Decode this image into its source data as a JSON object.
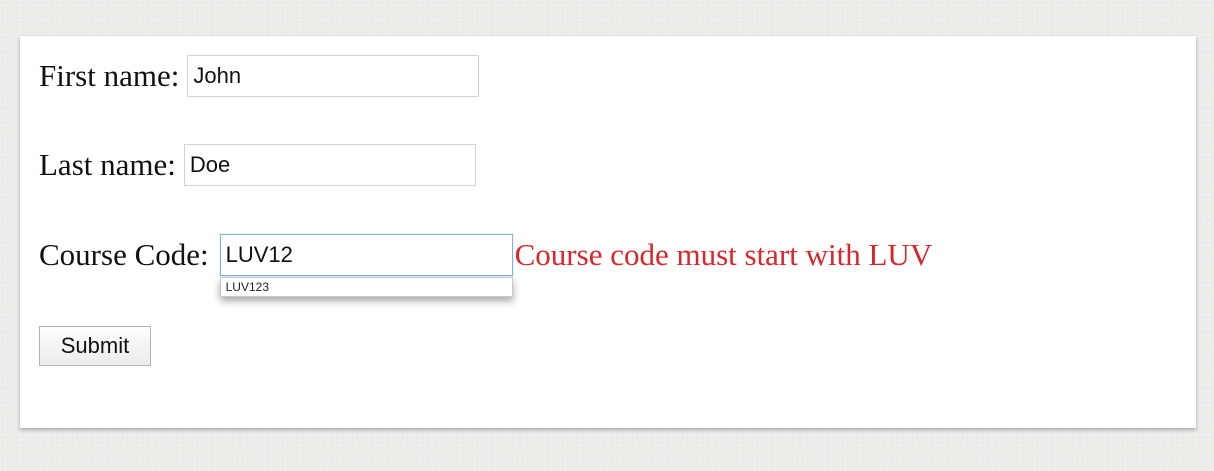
{
  "form": {
    "first_name": {
      "label": "First name:",
      "value": "John"
    },
    "last_name": {
      "label": "Last name:",
      "value": "Doe"
    },
    "course_code": {
      "label": "Course Code:",
      "value": "LUV12",
      "error": "Course code must start with LUV",
      "autocomplete_suggestions": [
        "LUV123"
      ]
    },
    "submit_label": "Submit"
  },
  "colors": {
    "error": "#d8262b",
    "focus_border": "#87b2da",
    "background": "#efedea"
  }
}
